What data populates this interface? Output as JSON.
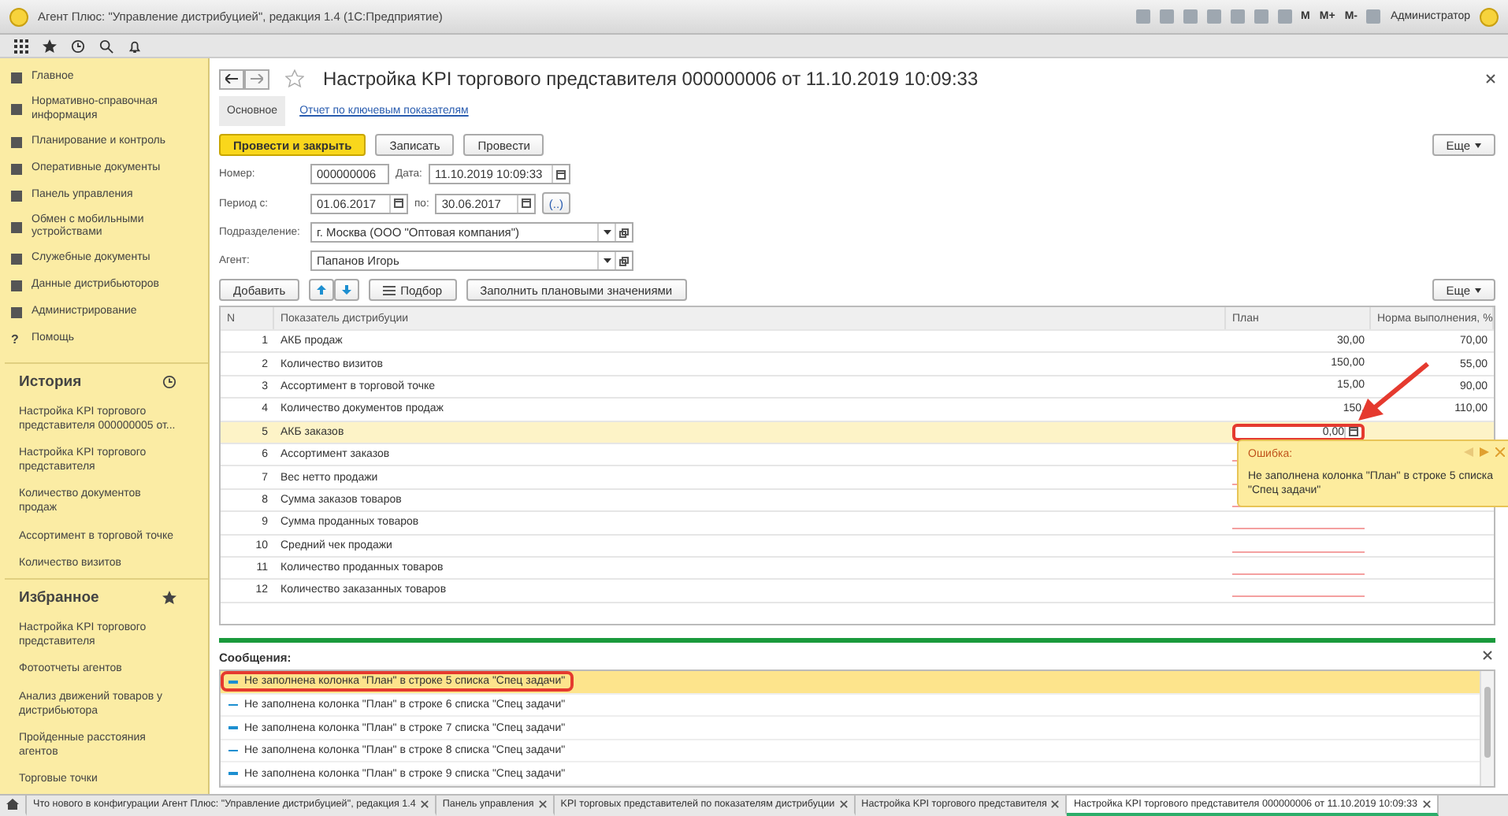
{
  "window": {
    "title": "Агент Плюс: \"Управление дистрибуцией\", редакция 1.4  (1С:Предприятие)",
    "user": "Администратор",
    "memory_buttons": [
      "M",
      "M+",
      "M-"
    ]
  },
  "sidebar": {
    "sections": [
      {
        "label": "Главное"
      },
      {
        "label": "Нормативно-справочная информация"
      },
      {
        "label": "Планирование и контроль"
      },
      {
        "label": "Оперативные документы"
      },
      {
        "label": "Панель управления"
      },
      {
        "label": "Обмен с мобильными устройствами"
      },
      {
        "label": "Служебные документы"
      },
      {
        "label": "Данные дистрибьюторов"
      },
      {
        "label": "Администрирование"
      },
      {
        "label": "Помощь",
        "glyph": "?"
      }
    ],
    "history": {
      "title": "История",
      "items": [
        "Настройка KPI торгового представителя 000000005 от...",
        "Настройка KPI торгового представителя",
        "Количество документов продаж",
        "Ассортимент в торговой точке",
        "Количество визитов"
      ]
    },
    "favorites": {
      "title": "Избранное",
      "items": [
        "Настройка KPI торгового представителя",
        "Фотоотчеты агентов",
        "Анализ движений товаров у дистрибьютора",
        "Пройденные расстояния агентов",
        "Торговые точки"
      ]
    }
  },
  "form": {
    "title": "Настройка KPI торгового представителя 000000006 от 11.10.2019 10:09:33",
    "tabs": [
      {
        "label": "Основное",
        "selected": true
      },
      {
        "label": "Отчет по ключевым показателям",
        "selected": false
      }
    ],
    "buttons": [
      {
        "label": "Провести и закрыть",
        "primary": true
      },
      {
        "label": "Записать",
        "primary": false
      },
      {
        "label": "Провести",
        "primary": false
      }
    ],
    "more_label": "Еще",
    "table_more_label": "Еще",
    "number": {
      "label": "Номер:",
      "value": "000000006"
    },
    "date": {
      "label": "Дата:",
      "value": "11.10.2019 10:09:33"
    },
    "period": {
      "label": "Период с:",
      "from": "01.06.2017",
      "to_label": "по:",
      "to": "30.06.2017",
      "extra": "(..)"
    },
    "division": {
      "label": "Подразделение:",
      "value": "г. Москва  (ООО \"Оптовая компания\")"
    },
    "agent": {
      "label": "Агент:",
      "value": "Папанов Игорь"
    },
    "table_buttons": [
      "Добавить",
      "Подбор",
      "Заполнить плановыми значениями"
    ],
    "table": {
      "columns": [
        "N",
        "Показатель дистрибуции",
        "План",
        "Норма выполнения, %"
      ],
      "rows": [
        {
          "n": "1",
          "name": "АКБ продаж",
          "plan": "30,00",
          "norm": "70,00",
          "selected": false,
          "error": false
        },
        {
          "n": "2",
          "name": "Количество визитов",
          "plan": "150,00",
          "norm": "55,00",
          "selected": false,
          "error": false
        },
        {
          "n": "3",
          "name": "Ассортимент в торговой точке",
          "plan": "15,00",
          "norm": "90,00",
          "selected": false,
          "error": false
        },
        {
          "n": "4",
          "name": "Количество документов продаж",
          "plan": "150,",
          "norm": "110,00",
          "selected": false,
          "error": false
        },
        {
          "n": "5",
          "name": "АКБ заказов",
          "plan": "0,00",
          "norm": "",
          "selected": true,
          "error": true
        },
        {
          "n": "6",
          "name": "Ассортимент заказов",
          "plan": "",
          "norm": "",
          "selected": false,
          "error": true
        },
        {
          "n": "7",
          "name": "Вес нетто продажи",
          "plan": "",
          "norm": "",
          "selected": false,
          "error": true
        },
        {
          "n": "8",
          "name": "Сумма заказов товаров",
          "plan": "",
          "norm": "",
          "selected": false,
          "error": true
        },
        {
          "n": "9",
          "name": "Сумма проданных товаров",
          "plan": "",
          "norm": "",
          "selected": false,
          "error": true
        },
        {
          "n": "10",
          "name": "Средний чек продажи",
          "plan": "",
          "norm": "",
          "selected": false,
          "error": true
        },
        {
          "n": "11",
          "name": "Количество проданных товаров",
          "plan": "",
          "norm": "",
          "selected": false,
          "error": true
        },
        {
          "n": "12",
          "name": "Количество заказанных товаров",
          "plan": "",
          "norm": "",
          "selected": false,
          "error": true
        }
      ]
    },
    "tooltip": {
      "title": "Ошибка:",
      "text": "Не заполнена колонка \"План\" в строке 5 списка \"Спец задачи\""
    },
    "messages": {
      "title": "Сообщения:",
      "items": [
        {
          "text": "Не заполнена колонка \"План\" в строке 5 списка \"Спец задачи\"",
          "selected": true
        },
        {
          "text": "Не заполнена колонка \"План\" в строке 6 списка \"Спец задачи\"",
          "selected": false
        },
        {
          "text": "Не заполнена колонка \"План\" в строке 7 списка \"Спец задачи\"",
          "selected": false
        },
        {
          "text": "Не заполнена колонка \"План\" в строке 8 списка \"Спец задачи\"",
          "selected": false
        },
        {
          "text": "Не заполнена колонка \"План\" в строке 9 списка \"Спец задачи\"",
          "selected": false
        }
      ]
    }
  },
  "taskbar": [
    {
      "label": "Что нового в конфигурации Агент Плюс: \"Управление дистрибуцией\", редакция 1.4",
      "selected": false
    },
    {
      "label": "Панель управления",
      "selected": false
    },
    {
      "label": "KPI торговых представителей по показателям дистрибуции",
      "selected": false
    },
    {
      "label": "Настройка KPI торгового представителя",
      "selected": false
    },
    {
      "label": "Настройка KPI торгового представителя 000000006 от 11.10.2019 10:09:33",
      "selected": true
    }
  ]
}
